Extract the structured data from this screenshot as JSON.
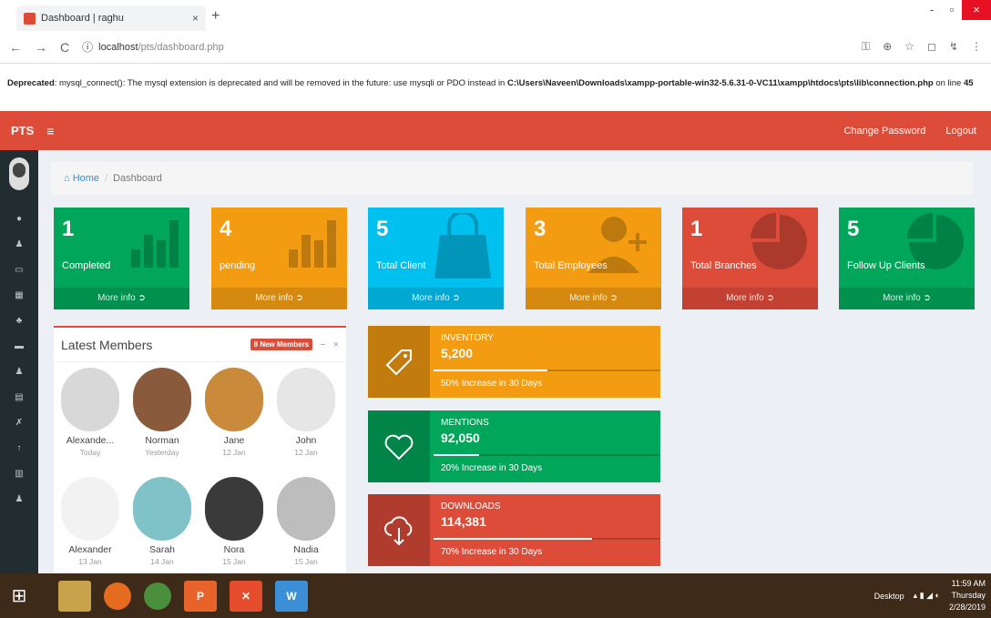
{
  "browser": {
    "tab_title": "Dashboard | raghu",
    "tab_close": "×",
    "new_tab": "+",
    "url_host": "localhost",
    "url_path": "/pts/dashboard.php",
    "win_min": "-",
    "win_max": "▫",
    "win_close": "×"
  },
  "warning": {
    "label": "Deprecated",
    "message": ": mysql_connect(): The mysql extension is deprecated and will be removed in the future: use mysqli or PDO instead in ",
    "path": "C:\\Users\\Naveen\\Downloads\\xampp-portable-win32-5.6.31-0-VC11\\xampp\\htdocs\\pts\\lib\\connection.php",
    "line_text": " on line ",
    "line_no": "45"
  },
  "topbar": {
    "brand": "PTS",
    "change_password": "Change Password",
    "logout": "Logout"
  },
  "breadcrumb": {
    "home": "Home",
    "separator": "/",
    "current": "Dashboard"
  },
  "stats": [
    {
      "number": "1",
      "label": "Completed",
      "more": "More info",
      "color": "#00a65a"
    },
    {
      "number": "4",
      "label": "pending",
      "more": "More info",
      "color": "#f39c12"
    },
    {
      "number": "5",
      "label": "Total Client",
      "more": "More info",
      "color": "#00c0ef"
    },
    {
      "number": "3",
      "label": "Total Employees",
      "more": "More info",
      "color": "#f39c12"
    },
    {
      "number": "1",
      "label": "Total Branches",
      "more": "More info",
      "color": "#dd4b39"
    },
    {
      "number": "5",
      "label": "Follow Up Clients",
      "more": "More info",
      "color": "#00a65a"
    }
  ],
  "members_panel": {
    "title": "Latest Members",
    "badge": "8 New Members",
    "members": [
      {
        "name": "Alexande...",
        "date": "Today"
      },
      {
        "name": "Norman",
        "date": "Yesterday"
      },
      {
        "name": "Jane",
        "date": "12 Jan"
      },
      {
        "name": "John",
        "date": "12 Jan"
      },
      {
        "name": "Alexander",
        "date": "13 Jan"
      },
      {
        "name": "Sarah",
        "date": "14 Jan"
      },
      {
        "name": "Nora",
        "date": "15 Jan"
      },
      {
        "name": "Nadia",
        "date": "15 Jan"
      }
    ]
  },
  "info_boxes": [
    {
      "title": "INVENTORY",
      "value": "5,200",
      "desc": "50% Increase in 30 Days",
      "progress": 0.5,
      "color": "#f39c12",
      "icon": "tag-icon"
    },
    {
      "title": "MENTIONS",
      "value": "92,050",
      "desc": "20% Increase in 30 Days",
      "progress": 0.2,
      "color": "#00a65a",
      "icon": "heart-icon"
    },
    {
      "title": "DOWNLOADS",
      "value": "114,381",
      "desc": "70% Increase in 30 Days",
      "progress": 0.7,
      "color": "#dd4b39",
      "icon": "cloud-download-icon"
    }
  ],
  "taskbar": {
    "desktop": "Desktop",
    "time": "11:59 AM",
    "day": "Thursday",
    "date": "2/28/2019"
  }
}
